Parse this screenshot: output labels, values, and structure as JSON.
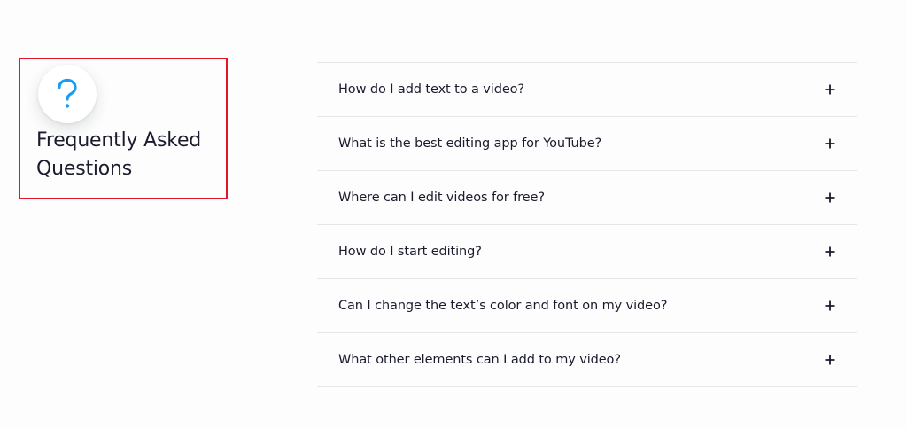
{
  "faq": {
    "title": "Frequently Asked Questions",
    "icon": "question-mark-icon",
    "icon_color": "#1a9cf0",
    "highlight_color": "#e0162b",
    "toggle_icon": "plus-icon",
    "items": [
      {
        "question": "How do I add text to a video?"
      },
      {
        "question": "What is the best editing app for YouTube?"
      },
      {
        "question": "Where can I edit videos for free?"
      },
      {
        "question": "How do I start editing?"
      },
      {
        "question": "Can I change the text’s color and font on my video?"
      },
      {
        "question": "What other elements can I add to my video?"
      }
    ]
  }
}
